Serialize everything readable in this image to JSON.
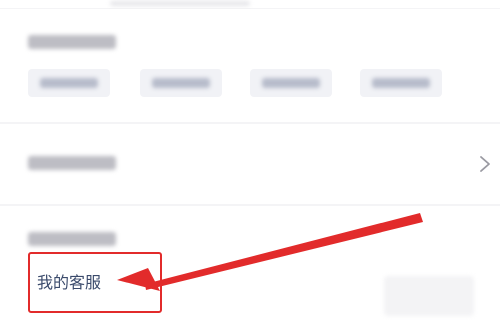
{
  "colors": {
    "page_background": "#f4f4f6",
    "card_background": "#ffffff",
    "annotation_red": "#e22b2b",
    "link_text": "#3a4a6b"
  },
  "icons": {
    "chevron": "chevron-right-icon",
    "arrow": "arrow-left-icon"
  },
  "service_item": {
    "label": "我的客服"
  }
}
